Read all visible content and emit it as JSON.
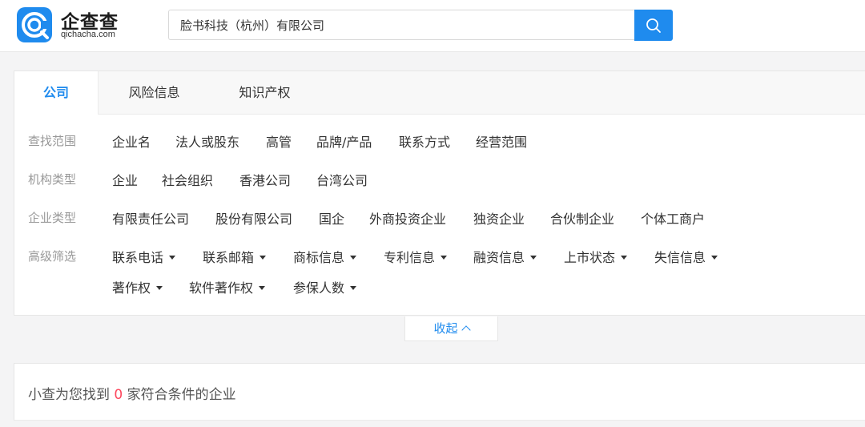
{
  "header": {
    "logo_cn": "企查查",
    "logo_en": "qichacha.com",
    "search_value": "脸书科技（杭州）有限公司",
    "accent": "#1f8bee"
  },
  "tabs": [
    "公司",
    "风险信息",
    "知识产权"
  ],
  "filters": {
    "scope": {
      "label": "查找范围",
      "options": [
        "企业名",
        "法人或股东",
        "高管",
        "品牌/产品",
        "联系方式",
        "经营范围"
      ]
    },
    "org_type": {
      "label": "机构类型",
      "options": [
        "企业",
        "社会组织",
        "香港公司",
        "台湾公司"
      ]
    },
    "company_type": {
      "label": "企业类型",
      "options": [
        "有限责任公司",
        "股份有限公司",
        "国企",
        "外商投资企业",
        "独资企业",
        "合伙制企业",
        "个体工商户"
      ]
    },
    "advanced": {
      "label": "高级筛选",
      "options": [
        "联系电话",
        "联系邮箱",
        "商标信息",
        "专利信息",
        "融资信息",
        "上市状态",
        "失信信息",
        "著作权",
        "软件著作权",
        "参保人数"
      ]
    }
  },
  "collapse_label": "收起",
  "result": {
    "prefix": "小查为您找到 ",
    "count": "0",
    "suffix": " 家符合条件的企业",
    "count_color": "#fd485e"
  }
}
